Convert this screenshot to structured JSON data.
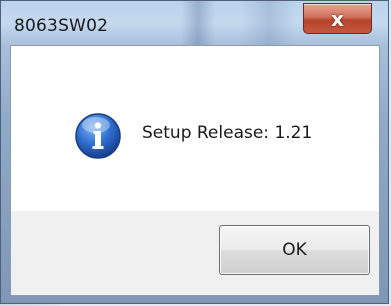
{
  "window": {
    "title": "8063SW02",
    "close_glyph": "x",
    "close_icon": "close-icon"
  },
  "message": {
    "icon": "info-icon",
    "text": "Setup Release: 1.21"
  },
  "buttons": {
    "ok_label": "OK"
  },
  "colors": {
    "close_button": "#c85a42",
    "info_icon": "#1f5fbf",
    "message_bg": "#ffffff",
    "footer_bg": "#f0f0f0"
  }
}
